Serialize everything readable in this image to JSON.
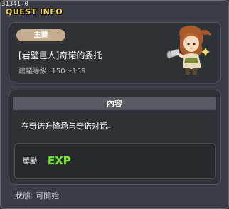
{
  "window": {
    "quest_id": "31341-0",
    "title": "QUEST INFO"
  },
  "quest": {
    "tag": "主要",
    "name": "[岩壁巨人]奇诺的委托",
    "level_text": "建議等級: 150～159",
    "npc_icon": "npc-character-icon"
  },
  "content": {
    "header": "內容",
    "description": "在奇诺升降场与奇诺对话。"
  },
  "reward": {
    "label": "獎勵",
    "exp_icon": "exp-icon",
    "exp_text": "EXP"
  },
  "status": {
    "text": "狀態: 可開始"
  },
  "colors": {
    "title": "#f2d24a",
    "tag_bg": "#c4ad8f",
    "exp_green": "#7ee23a"
  }
}
